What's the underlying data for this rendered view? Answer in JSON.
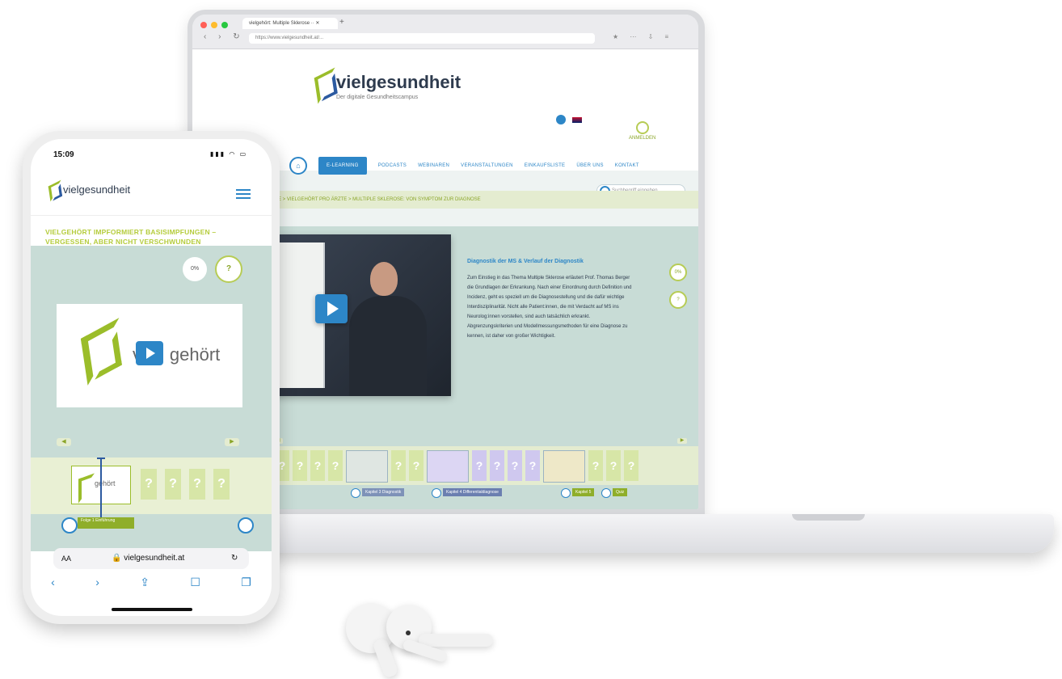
{
  "laptop": {
    "tab_title": "vielgehört: Multiple Sklerose ·· ✕",
    "new_tab": "+",
    "url": "https://www.vielgesundheit.at/...",
    "site": {
      "logo": "vielgesundheit",
      "tagline": "Der digitale Gesundheitscampus",
      "login_label": "ANMELDEN",
      "nav": [
        "E-LEARNING",
        "PODCASTS",
        "WEBINAREN",
        "VERANSTALTUNGEN",
        "EINKAUFSLISTE",
        "ÜBER UNS",
        "KONTAKT"
      ],
      "search_placeholder": "Suchbegriff eingeben",
      "breadcrumb": "HOME > VIELGEHÖRT PRO ÄRZTE > MULTIPLE SKLEROSE: VON SYMPTOM ZUR DIAGNOSE"
    },
    "video": {
      "heading": "Diagnostik der MS & Verlauf der Diagnostik",
      "text": "Zum Einstieg in das Thema Multiple Sklerose erläutert Prof. Thomas Berger die Grundlagen der Erkrankung. Nach einer Einordnung durch Definition und Incidenz, geht es speziell um die Diagnosestellung und die dafür wichtige Interdisziplinarität. Nicht alle Patient:innen, die mit Verdacht auf MS ins Neurolog:innen vorstellen, sind auch tatsächlich erkrankt. Abgrenzungskriterien und Modellmessungsmethoden für eine Diagnose zu kennen, ist daher von großer Wichtigkeit.",
      "side_ring_top": "0%",
      "side_ring_quiz": "?"
    },
    "timeline": {
      "cell_glyph": "?",
      "labels": [
        "Kapitel 3 Diagnostik",
        "Kapitel 4 Differentialdiagnose",
        "Kapitel 5",
        "Quiz"
      ]
    }
  },
  "phone": {
    "time": "15:09",
    "status_icons": "▮▮▮ ◠ ▭",
    "logo": "vielgesundheit",
    "title": "VIELGEHÖRT IMPFORMIERT BASISIMPFUNGEN – VERGESSEN, ABER NICHT VERSCHWUNDEN",
    "progress": "0%",
    "quiz_glyph": "?",
    "video_word": "gehört",
    "video_prefix": "vi",
    "cell_glyph": "?",
    "mini_word": "gehört",
    "timeline_label": "Folge 1 Einführung",
    "url_aa": "AA",
    "url": "🔒 vielgesundheit.at",
    "reload": "↻",
    "toolbar": [
      "‹",
      "›",
      "⇪",
      "☐",
      "❐"
    ]
  },
  "colors": {
    "brand_blue": "#2d86c7",
    "brand_green": "#9bbd2a",
    "panel_teal": "#c8dcd6"
  }
}
